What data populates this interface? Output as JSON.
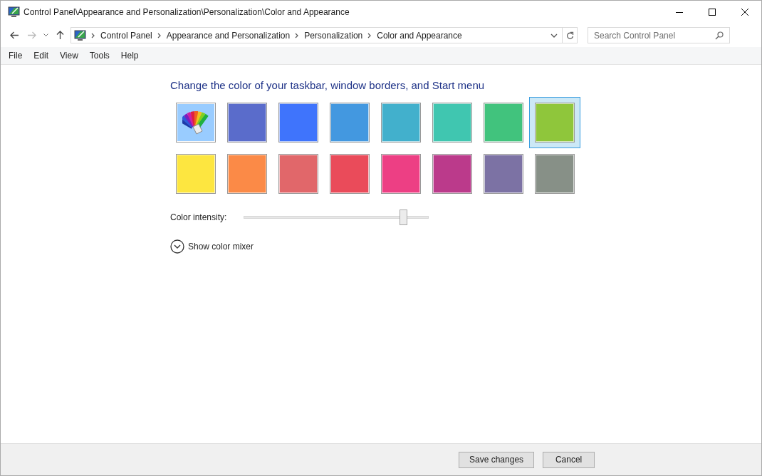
{
  "window": {
    "title": "Control Panel\\Appearance and Personalization\\Personalization\\Color and Appearance"
  },
  "breadcrumb": [
    "Control Panel",
    "Appearance and Personalization",
    "Personalization",
    "Color and Appearance"
  ],
  "search": {
    "placeholder": "Search Control Panel"
  },
  "menu": [
    "File",
    "Edit",
    "View",
    "Tools",
    "Help"
  ],
  "heading": "Change the color of your taskbar, window borders, and Start menu",
  "swatches": [
    {
      "kind": "auto",
      "selected": false
    },
    {
      "kind": "color",
      "color": "#5a6ccb",
      "selected": false
    },
    {
      "kind": "color",
      "color": "#3f74fc",
      "selected": false
    },
    {
      "kind": "color",
      "color": "#4398e0",
      "selected": false
    },
    {
      "kind": "color",
      "color": "#42b0cc",
      "selected": false
    },
    {
      "kind": "color",
      "color": "#40c6b0",
      "selected": false
    },
    {
      "kind": "color",
      "color": "#41c37d",
      "selected": false
    },
    {
      "kind": "color",
      "color": "#8fc63b",
      "selected": true
    },
    {
      "kind": "color",
      "color": "#fde640",
      "selected": false
    },
    {
      "kind": "color",
      "color": "#fb8a47",
      "selected": false
    },
    {
      "kind": "color",
      "color": "#e1676a",
      "selected": false
    },
    {
      "kind": "color",
      "color": "#ea4b5a",
      "selected": false
    },
    {
      "kind": "color",
      "color": "#ed3f84",
      "selected": false
    },
    {
      "kind": "color",
      "color": "#bb3a8b",
      "selected": false
    },
    {
      "kind": "color",
      "color": "#7c72a4",
      "selected": false
    },
    {
      "kind": "color",
      "color": "#879087",
      "selected": false
    }
  ],
  "intensity": {
    "label": "Color intensity:",
    "level": 0.86
  },
  "mixer": {
    "label": "Show color mixer",
    "expanded": false
  },
  "buttons": [
    "Save changes",
    "Cancel"
  ]
}
